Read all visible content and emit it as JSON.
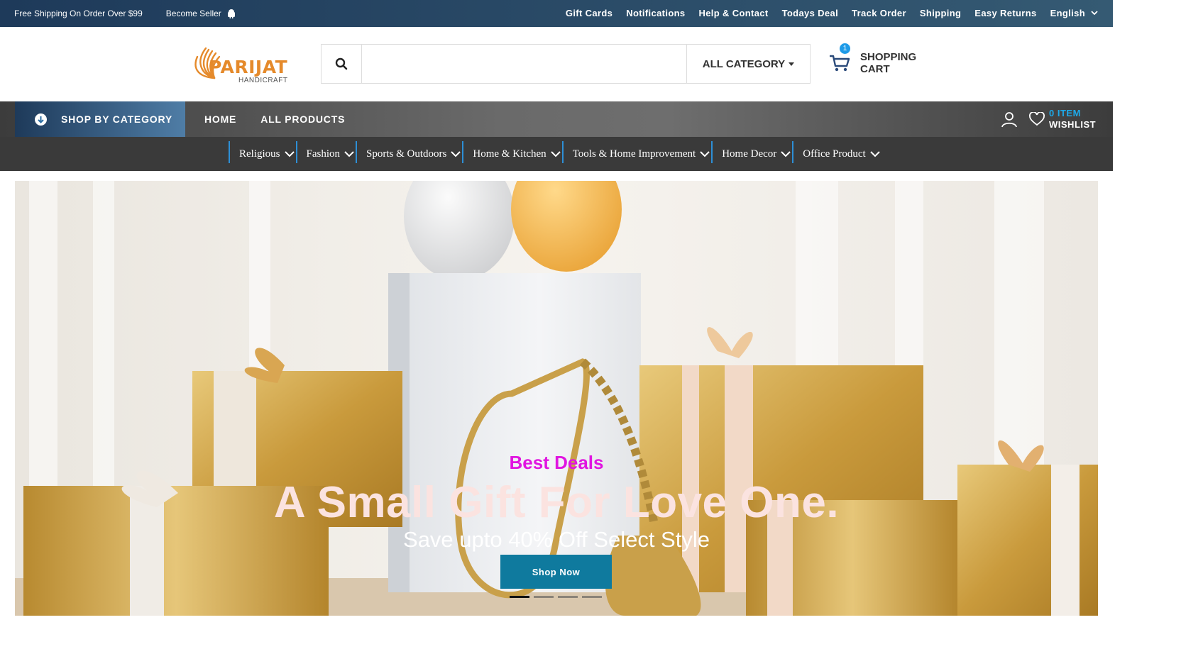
{
  "topbar": {
    "shipping_text": "Free Shipping On Order Over $99",
    "seller_text": "Become Seller",
    "links": [
      "Gift Cards",
      "Notifications",
      "Help & Contact",
      "Todays Deal",
      "Track Order",
      "Shipping",
      "Easy Returns"
    ],
    "language": "English"
  },
  "header": {
    "logo_text": "PARIJAT",
    "logo_sub": "HANDICRAFT",
    "search": {
      "placeholder": "",
      "value": ""
    },
    "category_select": "ALL CATEGORY",
    "cart": {
      "count": "1",
      "label": "SHOPPING CART"
    }
  },
  "nav": {
    "shop_by_category": "SHOP BY CATEGORY",
    "links": [
      "HOME",
      "ALL PRODUCTS"
    ],
    "wishlist_count": "0 ITEM",
    "wishlist_label": "WISHLIST"
  },
  "categories": [
    "Religious",
    "Fashion",
    "Sports & Outdoors",
    "Home & Kitchen",
    "Tools & Home Improvement",
    "Home Decor",
    "Office Product"
  ],
  "hero": {
    "tagline": "Best Deals",
    "title": "A Small Gift For Love One.",
    "subtitle": "Save upto 40% Off Select Style",
    "button": "Shop Now",
    "slides": 4,
    "active_slide": 1
  },
  "colors": {
    "topbar": "#1e3a5a",
    "accent": "#1ea9e8",
    "tagline": "#e015e0",
    "button": "#0f7a9e",
    "category_divider": "#2d8fd6"
  }
}
